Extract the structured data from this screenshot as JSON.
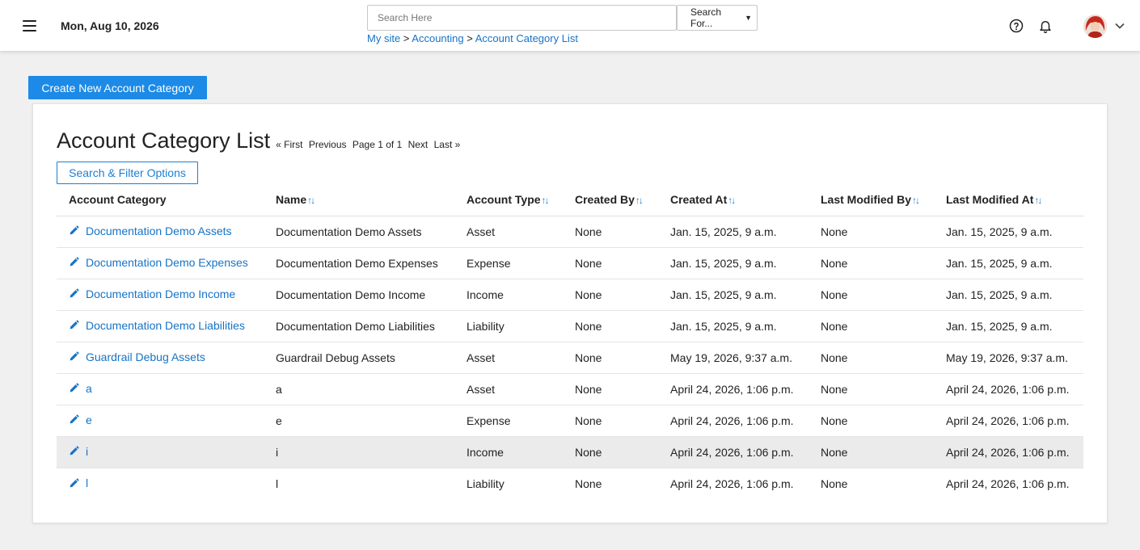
{
  "header": {
    "date": "Mon, Aug 10, 2026",
    "search_placeholder": "Search Here",
    "search_select": "Search For...",
    "breadcrumb": [
      "My site",
      "Accounting",
      "Account Category List"
    ],
    "breadcrumb_sep": ">",
    "icons": [
      "menu-icon",
      "help-icon",
      "bell-icon",
      "avatar",
      "chevron-down-icon"
    ]
  },
  "toolbar": {
    "create_label": "Create New Account Category"
  },
  "card": {
    "title": "Account Category List",
    "pagination": {
      "first": "« First",
      "previous": "Previous",
      "page_info": "Page 1 of 1",
      "next": "Next",
      "last": "Last »"
    },
    "filter_label": "Search & Filter Options"
  },
  "table": {
    "sort_glyph": "↑↓",
    "columns": [
      "Account Category",
      "Name",
      "Account Type",
      "Created By",
      "Created At",
      "Last Modified By",
      "Last Modified At"
    ],
    "rows": [
      [
        "Documentation Demo Assets",
        "Documentation Demo Assets",
        "Asset",
        "None",
        "Jan. 15, 2025, 9 a.m.",
        "None",
        "Jan. 15, 2025, 9 a.m."
      ],
      [
        "Documentation Demo Expenses",
        "Documentation Demo Expenses",
        "Expense",
        "None",
        "Jan. 15, 2025, 9 a.m.",
        "None",
        "Jan. 15, 2025, 9 a.m."
      ],
      [
        "Documentation Demo Income",
        "Documentation Demo Income",
        "Income",
        "None",
        "Jan. 15, 2025, 9 a.m.",
        "None",
        "Jan. 15, 2025, 9 a.m."
      ],
      [
        "Documentation Demo Liabilities",
        "Documentation Demo Liabilities",
        "Liability",
        "None",
        "Jan. 15, 2025, 9 a.m.",
        "None",
        "Jan. 15, 2025, 9 a.m."
      ],
      [
        "Guardrail Debug Assets",
        "Guardrail Debug Assets",
        "Asset",
        "None",
        "May 19, 2026, 9:37 a.m.",
        "None",
        "May 19, 2026, 9:37 a.m."
      ],
      [
        "a",
        "a",
        "Asset",
        "None",
        "April 24, 2026, 1:06 p.m.",
        "None",
        "April 24, 2026, 1:06 p.m."
      ],
      [
        "e",
        "e",
        "Expense",
        "None",
        "April 24, 2026, 1:06 p.m.",
        "None",
        "April 24, 2026, 1:06 p.m."
      ],
      [
        "i",
        "i",
        "Income",
        "None",
        "April 24, 2026, 1:06 p.m.",
        "None",
        "April 24, 2026, 1:06 p.m."
      ],
      [
        "l",
        "l",
        "Liability",
        "None",
        "April 24, 2026, 1:06 p.m.",
        "None",
        "April 24, 2026, 1:06 p.m."
      ]
    ]
  },
  "colors": {
    "accent": "#1c8ae6",
    "link": "#1673c7",
    "background": "#f0f0f0",
    "row_highlight": "#ebebeb"
  }
}
